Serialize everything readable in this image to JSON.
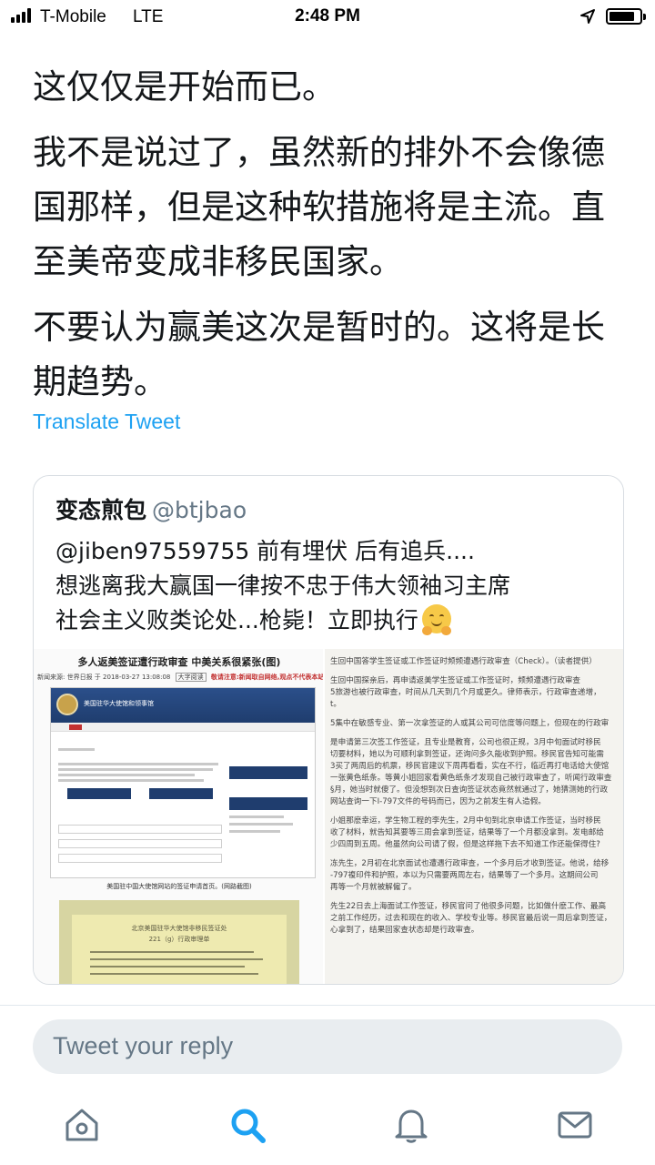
{
  "status_bar": {
    "carrier": "T-Mobile",
    "network": "LTE",
    "time": "2:48 PM",
    "signal_bars": 4,
    "battery_level": 0.85,
    "icons": [
      "signal-icon",
      "location-arrow-icon",
      "battery-icon"
    ]
  },
  "tweet": {
    "paragraphs": [
      "这仅仅是开始而已。",
      "我不是说过了，虽然新的排外不会像德国那样，但是这种软措施将是主流。直至美帝变成非移民国家。",
      "不要认为赢美这次是暂时的。这将是长期趋势。"
    ],
    "translate_label": "Translate Tweet"
  },
  "quoted_tweet": {
    "name": "变态煎包",
    "handle": "@btjbao",
    "text_line1": "@jiben97559755 前有埋伏 后有追兵....",
    "text_line2": "想逃离我大赢国一律按不忠于伟大领袖习主席",
    "text_line3": "社会主义败类论处...枪毙！立即执行",
    "emoji": "hugging-face-icon",
    "media": {
      "left": {
        "headline": "多人返美签证遭行政审查 中美关系很紧张(图)",
        "meta": "新闻来源: 世界日报 于 2018-03-27 13:08:08",
        "meta_font_btn": "大字阅读",
        "meta_warning": "敬请注意:新闻取自网络,观点不代表本站立场!",
        "site_title": "美国驻华大使馆和领事馆",
        "caption": "美国驻中国大使馆网站的签证申请首页。(网路截图)",
        "photo_title": "北京美国驻华大使馆非移民签证处",
        "photo_subtitle": "221（g）行政审理单"
      },
      "right_lines": [
        "生回中国答学生签证或工作签证时频频遭遇行政审查（Check）。（读者提供）",
        "生回中国探亲后，再申请返美学生签证或工作签证时，频频遭遇行政审查",
        "5旅游也被行政审查，时间从几天到几个月或更久。律师表示，行政审查递增，",
        "t。",
        "5集中在敏感专业、第一次拿签证的人或其公司可信度等问题上，但现在的行政审",
        "是申请第三次签工作签证，且专业是教育，公司也很正规，3月中旬面试时移民",
        "切要材料，她以为可顺利拿到签证，还询问多久能收到护照。移民官告知可能需",
        "3买了两周后的机票，移民官建议下周再看看，实在不行，临近再打电话给大使馆",
        "一张黄色纸条。等黄小姐回家看黄色纸条才发现自己被行政审查了，听闻行政审查",
        "§月，她当时就傻了。但没想到次日查询签证状态竟然就通过了，她猜测她的行政",
        "网站查询一下I-797文件的号码而已，因为之前发生有人造假。",
        "小姐那麽幸运，学生物工程的李先生，2月中旬到北京申请工作签证，当时移民",
        "收了材料，就告知其要等三周会拿到签证，结果等了一个月都没拿到。发电邮给",
        "少四周到五周。他虽然向公司请了假，但是这样拖下去不知道工作还能保得住?",
        "冻先生，2月初在北京面试也遭遇行政审查，一个多月后才收到签证。他说，给移",
        "-797複印件和护照，本以为只需要两周左右，结果等了一个多月。这期间公司",
        "再等一个月就被解僱了。",
        "先生22日去上海面试工作签证，移民官问了他很多问题，比如做什麽工作、最高",
        "之前工作经历，过去和现在的收入、学校专业等。移民官最后说一周后拿到签证，",
        "心拿到了，结果回家查状态却是行政审查。"
      ]
    }
  },
  "reply": {
    "placeholder": "Tweet your reply"
  },
  "tab_bar": {
    "items": [
      "home-icon",
      "search-icon",
      "notifications-icon",
      "messages-icon"
    ],
    "active": "search-icon",
    "active_color": "#1da1f2",
    "inactive_color": "#657786"
  }
}
